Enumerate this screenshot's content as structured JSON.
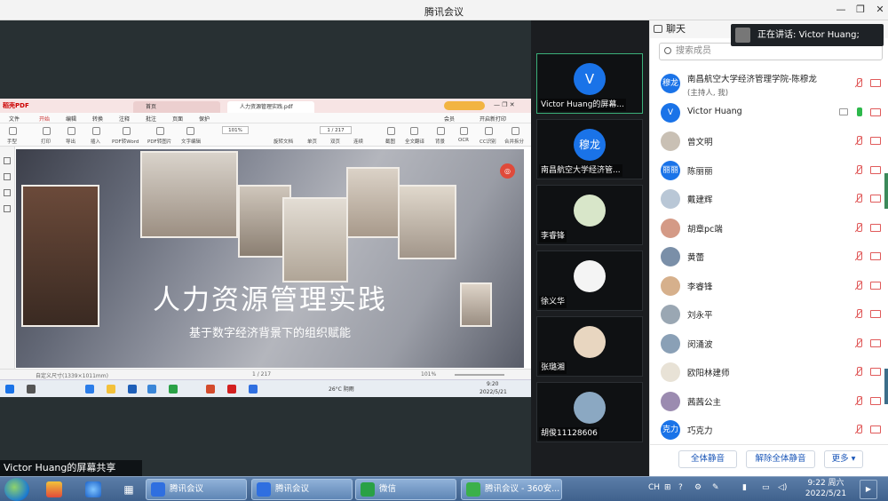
{
  "window": {
    "title": "腾讯会议"
  },
  "share": {
    "label": "Victor Huang的屏幕共享",
    "remote": {
      "app_name": "稻壳PDF",
      "tabs": [
        "首页",
        "人力资源管理实践.pdf"
      ],
      "menu": [
        "文件",
        "开始",
        "编辑",
        "转换",
        "注释",
        "批注",
        "页面",
        "保护",
        "会员",
        "开启新打印"
      ],
      "tools": [
        "手型",
        "选择",
        "打印",
        "导出",
        "插入",
        "PDF转Word",
        "PDF转图片",
        "文字编辑",
        "旋转文档",
        "单页",
        "双页",
        "连续",
        "截图",
        "全文翻译",
        "背景",
        "OCR",
        "CC识别",
        "合并拆分"
      ],
      "zoom": "101%",
      "page": "1 / 217",
      "doc_title": "人力资源管理实践",
      "doc_subtitle": "基于数字经济背景下的组织赋能",
      "status_left": "自定义尺寸(1339×1011mm)",
      "status_page": "1 / 217",
      "status_zoom": "101%",
      "task_weather": "26°C 阴雨",
      "task_time": "9:20",
      "task_date": "2022/5/21"
    }
  },
  "gallery": [
    {
      "name": "Victor Huang的屏幕...",
      "avatar": "V",
      "active": true
    },
    {
      "name": "南昌航空大学经济管...",
      "avatar": "穆龙",
      "active": false
    },
    {
      "name": "李睿锋",
      "avatar": "",
      "active": false
    },
    {
      "name": "徐义华",
      "avatar": "",
      "active": false
    },
    {
      "name": "张璐湘",
      "avatar": "",
      "active": false
    },
    {
      "name": "胡俊11128606",
      "avatar": "",
      "active": false
    }
  ],
  "panel": {
    "header": "聊天",
    "speaking_prefix": "正在讲话:",
    "speaking_name": "Victor Huang;",
    "search_placeholder": "搜索成员",
    "members": [
      {
        "name": "南昌航空大学经济管理学院-陈穆龙",
        "sub": "(主持人, 我)",
        "avatar": "穆龙",
        "mic_on": false,
        "share": false
      },
      {
        "name": "Victor Huang",
        "sub": "",
        "avatar": "V",
        "mic_on": true,
        "share": true
      },
      {
        "name": "曾文明",
        "sub": "",
        "avatar": "",
        "mic_on": false,
        "share": false
      },
      {
        "name": "陈丽丽",
        "sub": "",
        "avatar": "丽丽",
        "mic_on": false,
        "share": false
      },
      {
        "name": "戴建辉",
        "sub": "",
        "avatar": "",
        "mic_on": false,
        "share": false
      },
      {
        "name": "胡章pc端",
        "sub": "",
        "avatar": "",
        "mic_on": false,
        "share": false
      },
      {
        "name": "黄蕾",
        "sub": "",
        "avatar": "",
        "mic_on": false,
        "share": false
      },
      {
        "name": "李睿锋",
        "sub": "",
        "avatar": "",
        "mic_on": false,
        "share": false
      },
      {
        "name": "刘永平",
        "sub": "",
        "avatar": "",
        "mic_on": false,
        "share": false
      },
      {
        "name": "闵涌波",
        "sub": "",
        "avatar": "",
        "mic_on": false,
        "share": false
      },
      {
        "name": "欧阳林建师",
        "sub": "",
        "avatar": "",
        "mic_on": false,
        "share": false
      },
      {
        "name": "茜茜公主",
        "sub": "",
        "avatar": "",
        "mic_on": false,
        "share": false
      },
      {
        "name": "巧克力",
        "sub": "",
        "avatar": "克力",
        "mic_on": false,
        "share": false
      }
    ],
    "mute_all": "全体静音",
    "unmute_all": "解除全体静音",
    "more": "更多"
  },
  "taskbar": {
    "buttons": [
      "腾讯会议",
      "腾讯会议",
      "微信",
      "腾讯会议 - 360安..."
    ],
    "ime": "CH",
    "time": "9:22 周六",
    "date": "2022/5/21"
  }
}
